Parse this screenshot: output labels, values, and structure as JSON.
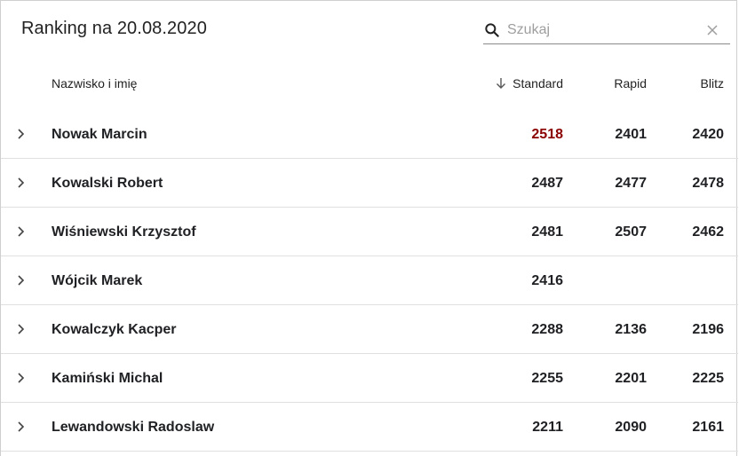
{
  "title": "Ranking na 20.08.2020",
  "search": {
    "placeholder": "Szukaj",
    "value": ""
  },
  "columns": {
    "name": "Nazwisko i imię",
    "standard": "Standard",
    "rapid": "Rapid",
    "blitz": "Blitz"
  },
  "highlight_color": "#8b0000",
  "rows": [
    {
      "name": "Nowak Marcin",
      "standard": "2518",
      "rapid": "2401",
      "blitz": "2420",
      "highlight": true
    },
    {
      "name": "Kowalski Robert",
      "standard": "2487",
      "rapid": "2477",
      "blitz": "2478"
    },
    {
      "name": "Wiśniewski Krzysztof",
      "standard": "2481",
      "rapid": "2507",
      "blitz": "2462"
    },
    {
      "name": "Wójcik Marek",
      "standard": "2416",
      "rapid": "",
      "blitz": ""
    },
    {
      "name": "Kowalczyk Kacper",
      "standard": "2288",
      "rapid": "2136",
      "blitz": "2196"
    },
    {
      "name": "Kamiński Michal",
      "standard": "2255",
      "rapid": "2201",
      "blitz": "2225"
    },
    {
      "name": "Lewandowski Radoslaw",
      "standard": "2211",
      "rapid": "2090",
      "blitz": "2161"
    }
  ]
}
